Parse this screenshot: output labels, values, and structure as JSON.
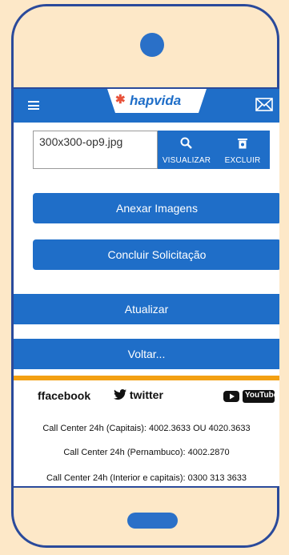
{
  "app": {
    "logo_text": "hapvida"
  },
  "file": {
    "name": "300x300-op9.jpg",
    "view_label": "VISUALIZAR",
    "delete_label": "EXCLUIR"
  },
  "buttons": {
    "attach": "Anexar Imagens",
    "finish": "Concluir Solicitação",
    "refresh": "Atualizar",
    "back": "Voltar..."
  },
  "social": {
    "facebook": "facebook",
    "twitter": "twitter",
    "youtube": "YouTube"
  },
  "contacts": [
    "Call Center 24h (Capitais): 4002.3633 OU 4020.3633",
    "Call Center 24h (Pernambuco): 4002.2870",
    "Call Center 24h (Interior e capitais): 0300 313 3633"
  ],
  "colors": {
    "brand_blue": "#1f6ec8",
    "accent_orange": "#f3a012",
    "background": "#fde8c8",
    "frame": "#2a4a9b"
  }
}
